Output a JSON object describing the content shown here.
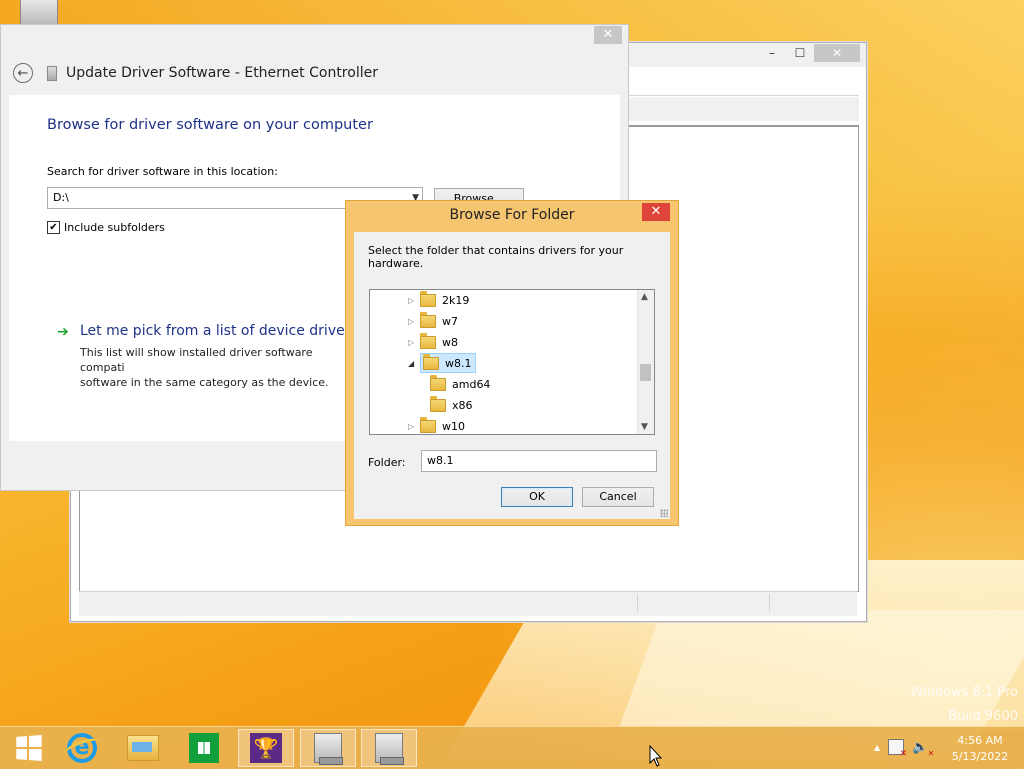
{
  "back_window": {
    "controls": {
      "minimize": "–",
      "maximize": "☐",
      "close": "✕"
    }
  },
  "update_window": {
    "title": "Update Driver Software - Ethernet Controller",
    "close_glyph": "✕",
    "heading": "Browse for driver software on your computer",
    "search_label": "Search for driver software in this location:",
    "location_value": "D:\\",
    "browse_label": "Browse...",
    "include_subfolders_label": "Include subfolders",
    "include_subfolders_checked": true,
    "pick_title": "Let me pick from a list of device drivers",
    "pick_desc_line1": "This list will show installed driver software compati",
    "pick_desc_line2": "software in the same category as the device."
  },
  "browse_dialog": {
    "title": "Browse For Folder",
    "close_glyph": "✕",
    "instruction": "Select the folder that contains drivers for your hardware.",
    "tree": [
      {
        "label": "2k19",
        "level": 1,
        "expanded": false,
        "selected": false
      },
      {
        "label": "w7",
        "level": 1,
        "expanded": false,
        "selected": false
      },
      {
        "label": "w8",
        "level": 1,
        "expanded": false,
        "selected": false
      },
      {
        "label": "w8.1",
        "level": 1,
        "expanded": true,
        "selected": true
      },
      {
        "label": "amd64",
        "level": 2,
        "expanded": null,
        "selected": false
      },
      {
        "label": "x86",
        "level": 2,
        "expanded": null,
        "selected": false
      },
      {
        "label": "w10",
        "level": 1,
        "expanded": false,
        "selected": false
      }
    ],
    "folder_label": "Folder:",
    "folder_value": "w8.1",
    "ok_label": "OK",
    "cancel_label": "Cancel"
  },
  "watermark": {
    "line1": "Windows 8.1 Pro",
    "line2": "Build 9600"
  },
  "taskbar": {
    "items": [
      {
        "name": "start-button",
        "icon": "windows-logo-icon"
      },
      {
        "name": "internet-explorer",
        "icon": "internet-explorer-icon"
      },
      {
        "name": "file-explorer",
        "icon": "folder-icon"
      },
      {
        "name": "store",
        "icon": "store-icon"
      },
      {
        "name": "trophy-app",
        "icon": "trophy-icon"
      },
      {
        "name": "device-manager",
        "icon": "device-icon"
      },
      {
        "name": "update-driver",
        "icon": "device-shield-icon"
      }
    ],
    "tray_chevron": "▲",
    "time": "4:56 AM",
    "date": "5/13/2022"
  },
  "colors": {
    "accent_heading": "#1e3287",
    "dialog_frame": "#f6c570",
    "close_red": "#e0453a",
    "selection": "#cce8ff"
  }
}
